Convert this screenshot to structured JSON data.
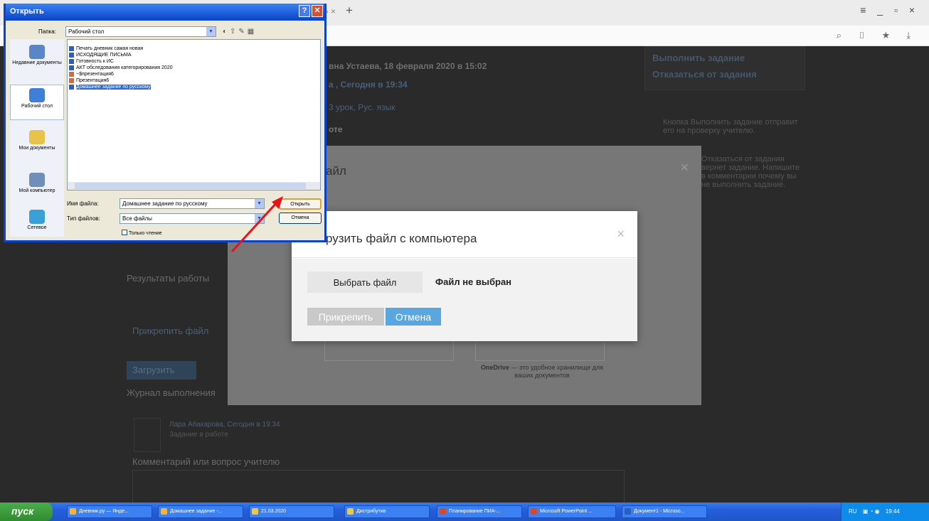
{
  "browser": {
    "tab_partial": "» ×",
    "new_tab": "+",
    "window_controls": "≡ _ ▫ ×",
    "addr_icons": "⌕ ▯ ★ ⤓"
  },
  "page": {
    "line1": "вна Устаева, 18 февраля 2020 в 15:02",
    "line2": "а , Сегодня в 19:34",
    "line3": "3 урок, Рус. язык",
    "line4": "оте",
    "right_actions": [
      "Выполнить задание",
      "Отказаться от задания"
    ],
    "hint_1": "Кнопка Выполнить задание отправит его на проверку учителю.",
    "hint_2": "Отказаться от задания вернет задание. Напишите в комментарии почему вы не выполнить задание.",
    "results_label": "Результаты работы",
    "attach_link": "Прикрепить файл",
    "upload_button": "Загрузить",
    "journal_label": "Журнал выполнения",
    "journal_entry_name": "Лара Абакарова, Сегодня в 19:34",
    "journal_entry_status": "Задание в работе",
    "comment_label": "Комментарий или вопрос учителю"
  },
  "mid_dialog": {
    "title": "айл",
    "close": "×",
    "onedrive_name": "OneDrive",
    "onedrive_text": " — это удобное хранилище для ваших документов"
  },
  "upload_dialog": {
    "title": "рузить файл с компьютера",
    "close": "×",
    "choose_button": "Выбрать файл",
    "no_file": "Файл не выбран",
    "attach_button": "Прикрепить",
    "cancel_button": "Отмена"
  },
  "open_dialog": {
    "title": "Открыть",
    "help": "?",
    "close": "✕",
    "folder_label": "Папка:",
    "folder_value": "Рабочий стол",
    "places": [
      "Недавние документы",
      "Рабочий стол",
      "Мои документы",
      "Мой компьютер",
      "Сетевое"
    ],
    "files": [
      "Печать дневник самая новая",
      "ИСХОДЯЩИЕ ПИСЬМА",
      "Готовность к ИС",
      "АКТ обследования категорирования 2020",
      "~$презентация6",
      "Презентация6",
      "Домашнее задание по русскому"
    ],
    "filename_label": "Имя файла:",
    "filename_value": "Домашнее задание по русскому",
    "filetype_label": "Тип файлов:",
    "filetype_value": "Все файлы",
    "readonly_label": "Только чтение",
    "open_button": "Открыть",
    "cancel_button": "Отмена"
  },
  "taskbar": {
    "start": "пуск",
    "items": [
      "Дневник.ру — Янде...",
      "Домашнее задание -...",
      "21.03.2020",
      "Дистрибутив",
      "Планирование ПИА-...",
      "Microsoft PowerPoint ...",
      "Документ1 - Microso..."
    ],
    "lang": "RU",
    "time": "19:44"
  }
}
